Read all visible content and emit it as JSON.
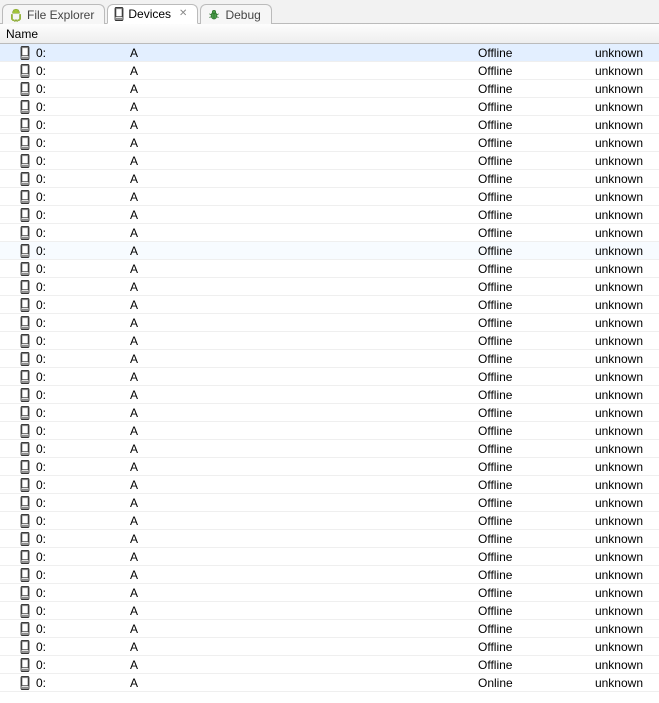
{
  "tabs": [
    {
      "label": "File Explorer",
      "icon": "android",
      "active": false,
      "closable": false
    },
    {
      "label": "Devices",
      "icon": "phone",
      "active": true,
      "closable": true
    },
    {
      "label": "Debug",
      "icon": "bug",
      "active": false,
      "closable": false
    }
  ],
  "column_header": "Name",
  "selected_row_index": 0,
  "hover_row_index": 11,
  "row_template": {
    "icon": "phone",
    "id": "0:",
    "col_a": "A",
    "unknown": "unknown"
  },
  "rows": [
    {
      "status": "Offline"
    },
    {
      "status": "Offline"
    },
    {
      "status": "Offline"
    },
    {
      "status": "Offline"
    },
    {
      "status": "Offline"
    },
    {
      "status": "Offline"
    },
    {
      "status": "Offline"
    },
    {
      "status": "Offline"
    },
    {
      "status": "Offline"
    },
    {
      "status": "Offline"
    },
    {
      "status": "Offline"
    },
    {
      "status": "Offline"
    },
    {
      "status": "Offline"
    },
    {
      "status": "Offline"
    },
    {
      "status": "Offline"
    },
    {
      "status": "Offline"
    },
    {
      "status": "Offline"
    },
    {
      "status": "Offline"
    },
    {
      "status": "Offline"
    },
    {
      "status": "Offline"
    },
    {
      "status": "Offline"
    },
    {
      "status": "Offline"
    },
    {
      "status": "Offline"
    },
    {
      "status": "Offline"
    },
    {
      "status": "Offline"
    },
    {
      "status": "Offline"
    },
    {
      "status": "Offline"
    },
    {
      "status": "Offline"
    },
    {
      "status": "Offline"
    },
    {
      "status": "Offline"
    },
    {
      "status": "Offline"
    },
    {
      "status": "Offline"
    },
    {
      "status": "Offline"
    },
    {
      "status": "Offline"
    },
    {
      "status": "Offline"
    },
    {
      "status": "Online"
    }
  ]
}
